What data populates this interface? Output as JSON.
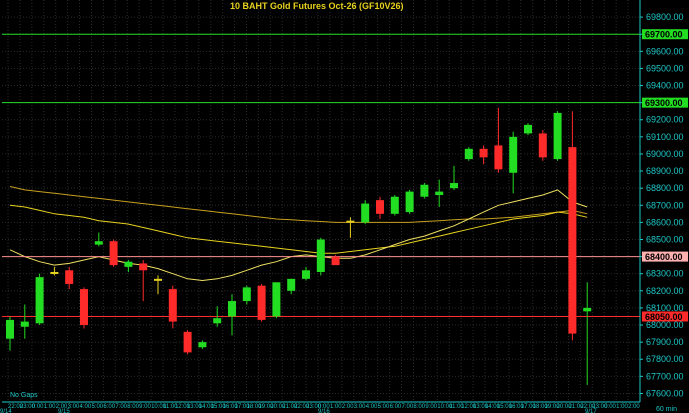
{
  "chart_data": {
    "type": "candlestick",
    "title": "10  BAHT  Gold  Futures  Oct-26  (GF10V26)",
    "ylim": [
      67550,
      69900
    ],
    "y_ticks": [
      67600,
      67700,
      67800,
      67900,
      68000,
      68100,
      68200,
      68300,
      68400,
      68500,
      68600,
      68700,
      68800,
      68900,
      69000,
      69100,
      69200,
      69300,
      69400,
      69500,
      69600,
      69700,
      69800
    ],
    "y_tick_labels": [
      "67600.00",
      "67700.00",
      "67800.00",
      "67900.00",
      "68000.00",
      "68100.00",
      "68200.00",
      "68300.00",
      "68400.00",
      "68500.00",
      "68600.00",
      "68700.00",
      "68800.00",
      "68900.00",
      "69000.00",
      "69100.00",
      "69200.00",
      "69300.00",
      "69400.00",
      "69500.00",
      "69600.00",
      "69700.00",
      "69800.00",
      "69900.00"
    ],
    "x_tick_labels": [
      "22:00",
      "23:00",
      "0:00",
      "1:00",
      "2:00",
      "3:00",
      "4:00",
      "5:00",
      "6:00",
      "7:00",
      "8:00",
      "9:00",
      "10:00",
      "11:00",
      "12:00",
      "13:00",
      "14:00",
      "15:00",
      "16:00",
      "17:00",
      "18:00",
      "19:00",
      "20:00",
      "21:00",
      "22:00",
      "23:00",
      "0:00",
      "1:00",
      "2:00",
      "3:00",
      "4:00",
      "5:00",
      "6:00",
      "7:00",
      "8:00",
      "9:00",
      "10:00",
      "11:00",
      "12:00",
      "13:00",
      "14:00",
      "15:00",
      "16:00",
      "17:00",
      "18:00",
      "19:00",
      "20:00",
      "21:00",
      "22:00",
      "23:00",
      "0:00",
      "1:00",
      "2:00"
    ],
    "date_labels": [
      "9/14",
      "9/15",
      "9/16",
      "9/17"
    ],
    "bottom_left_text": "No  Gaps",
    "bottom_right_text": "60  min",
    "colors": {
      "up": "#22dd22",
      "down": "#ff2a2a",
      "doji": "#e8d21e",
      "axis_text": "#1ec8c8",
      "grid": "#2a2a2a"
    },
    "candles": [
      {
        "o": 67920,
        "h": 68050,
        "l": 67850,
        "c": 68030
      },
      {
        "o": 67990,
        "h": 68120,
        "l": 67920,
        "c": 68020
      },
      {
        "o": 68010,
        "h": 68300,
        "l": 68000,
        "c": 68280
      },
      {
        "o": 68300,
        "h": 68340,
        "l": 68290,
        "c": 68310
      },
      {
        "o": 68320,
        "h": 68340,
        "l": 68210,
        "c": 68240
      },
      {
        "o": 68210,
        "h": 68220,
        "l": 67980,
        "c": 68000
      },
      {
        "o": 68470,
        "h": 68540,
        "l": 68460,
        "c": 68490
      },
      {
        "o": 68490,
        "h": 68500,
        "l": 68340,
        "c": 68350
      },
      {
        "o": 68340,
        "h": 68380,
        "l": 68310,
        "c": 68370
      },
      {
        "o": 68360,
        "h": 68380,
        "l": 68140,
        "c": 68320
      },
      {
        "o": 68270,
        "h": 68290,
        "l": 68180,
        "c": 68270
      },
      {
        "o": 68210,
        "h": 68230,
        "l": 67980,
        "c": 68020
      },
      {
        "o": 67960,
        "h": 67970,
        "l": 67830,
        "c": 67840
      },
      {
        "o": 67870,
        "h": 67910,
        "l": 67860,
        "c": 67900
      },
      {
        "o": 68010,
        "h": 68110,
        "l": 67990,
        "c": 68040
      },
      {
        "o": 68050,
        "h": 68180,
        "l": 67940,
        "c": 68140
      },
      {
        "o": 68140,
        "h": 68230,
        "l": 68120,
        "c": 68220
      },
      {
        "o": 68230,
        "h": 68240,
        "l": 68020,
        "c": 68030
      },
      {
        "o": 68050,
        "h": 68130,
        "l": 68040,
        "c": 68250
      },
      {
        "o": 68200,
        "h": 68270,
        "l": 68180,
        "c": 68270
      },
      {
        "o": 68270,
        "h": 68340,
        "l": 68260,
        "c": 68320
      },
      {
        "o": 68310,
        "h": 68510,
        "l": 68290,
        "c": 68500
      },
      {
        "o": 68400,
        "h": 68410,
        "l": 68390,
        "c": 68350
      },
      {
        "o": 68610,
        "h": 68630,
        "l": 68510,
        "c": 68600
      },
      {
        "o": 68600,
        "h": 68730,
        "l": 68590,
        "c": 68710
      },
      {
        "o": 68730,
        "h": 68750,
        "l": 68620,
        "c": 68650
      },
      {
        "o": 68650,
        "h": 68760,
        "l": 68640,
        "c": 68750
      },
      {
        "o": 68660,
        "h": 68790,
        "l": 68650,
        "c": 68780
      },
      {
        "o": 68750,
        "h": 68830,
        "l": 68740,
        "c": 68820
      },
      {
        "o": 68760,
        "h": 68850,
        "l": 68690,
        "c": 68780
      },
      {
        "o": 68800,
        "h": 68930,
        "l": 68790,
        "c": 68830
      },
      {
        "o": 68970,
        "h": 69040,
        "l": 68960,
        "c": 69030
      },
      {
        "o": 69030,
        "h": 69050,
        "l": 68940,
        "c": 68980
      },
      {
        "o": 69050,
        "h": 69270,
        "l": 68890,
        "c": 68910
      },
      {
        "o": 68890,
        "h": 69130,
        "l": 68770,
        "c": 69100
      },
      {
        "o": 69120,
        "h": 69180,
        "l": 69110,
        "c": 69170
      },
      {
        "o": 69120,
        "h": 69140,
        "l": 68960,
        "c": 68980
      },
      {
        "o": 68970,
        "h": 69250,
        "l": 68960,
        "c": 69240
      },
      {
        "o": 69040,
        "h": 69250,
        "l": 67910,
        "c": 67950
      },
      {
        "o": 68080,
        "h": 68250,
        "l": 67650,
        "c": 68100
      }
    ],
    "moving_averages": [
      {
        "values": [
          68810,
          68790,
          68780,
          68770,
          68760,
          68750,
          68740,
          68730,
          68720,
          68710,
          68700,
          68690,
          68680,
          68670,
          68660,
          68650,
          68640,
          68630,
          68620,
          68615,
          68610,
          68605,
          68600,
          68600,
          68600,
          68600,
          68600,
          68600,
          68605,
          68610,
          68615,
          68620,
          68620,
          68625,
          68630,
          68640,
          68650,
          68660,
          68670,
          68650
        ]
      },
      {
        "values": [
          68700,
          68690,
          68670,
          68650,
          68640,
          68630,
          68610,
          68600,
          68590,
          68570,
          68550,
          68530,
          68510,
          68500,
          68490,
          68480,
          68470,
          68460,
          68450,
          68440,
          68430,
          68420,
          68420,
          68430,
          68440,
          68450,
          68460,
          68480,
          68500,
          68520,
          68540,
          68560,
          68580,
          68600,
          68620,
          68630,
          68640,
          68660,
          68650,
          68630
        ]
      },
      {
        "values": [
          68440,
          68400,
          68370,
          68350,
          68360,
          68380,
          68400,
          68380,
          68360,
          68350,
          68330,
          68300,
          68270,
          68260,
          68270,
          68290,
          68320,
          68350,
          68370,
          68400,
          68410,
          68400,
          68390,
          68390,
          68410,
          68440,
          68470,
          68500,
          68520,
          68550,
          68580,
          68620,
          68660,
          68700,
          68720,
          68740,
          68760,
          68790,
          68720,
          68690
        ]
      }
    ],
    "ma_colors": [
      "#c8a020",
      "#e8d21e",
      "#f0e060"
    ],
    "horizontal_lines": [
      {
        "value": 69700,
        "label": "69700.00",
        "color": "#22dd22",
        "label_bg": "#22dd22",
        "label_fg": "#000000"
      },
      {
        "value": 69300,
        "label": "69300.00",
        "color": "#22dd22",
        "label_bg": "#22dd22",
        "label_fg": "#000000"
      },
      {
        "value": 68400,
        "label": "68400.00",
        "color": "#ff9090",
        "label_bg": "#ffb0b0",
        "label_fg": "#000000"
      },
      {
        "value": 68050,
        "label": "68050.00",
        "color": "#ff2a2a",
        "label_bg": "#ff2a2a",
        "label_fg": "#000000"
      }
    ]
  }
}
